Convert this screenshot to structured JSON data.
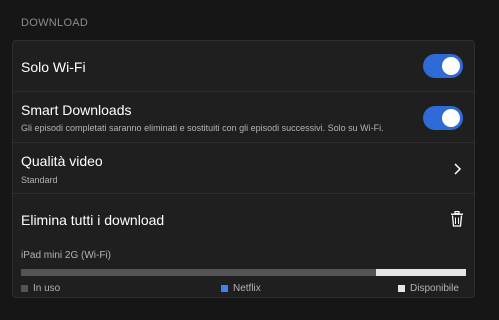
{
  "section": {
    "title": "DOWNLOAD"
  },
  "settings": {
    "wifi_only": {
      "label": "Solo Wi-Fi",
      "enabled": true
    },
    "smart_downloads": {
      "label": "Smart Downloads",
      "description": "Gli episodi completati saranno eliminati e sostituiti con gli episodi successivi. Solo su Wi-Fi.",
      "enabled": true
    },
    "video_quality": {
      "label": "Qualità video",
      "value": "Standard"
    },
    "delete_all": {
      "label": "Elimina tutti i download"
    }
  },
  "storage": {
    "device": "iPad mini 2G (Wi-Fi)",
    "used_fraction": 0.797,
    "netflix_fraction": 0.0,
    "legend": {
      "in_use": "In uso",
      "netflix": "Netflix",
      "available": "Disponibile"
    }
  },
  "colors": {
    "accent": "#2f6bd6",
    "in_use": "#545454",
    "netflix": "#3b82f6",
    "available": "#e5e5e5"
  },
  "icons": {
    "chevron": "chevron-right-icon",
    "trash": "trash-icon"
  }
}
